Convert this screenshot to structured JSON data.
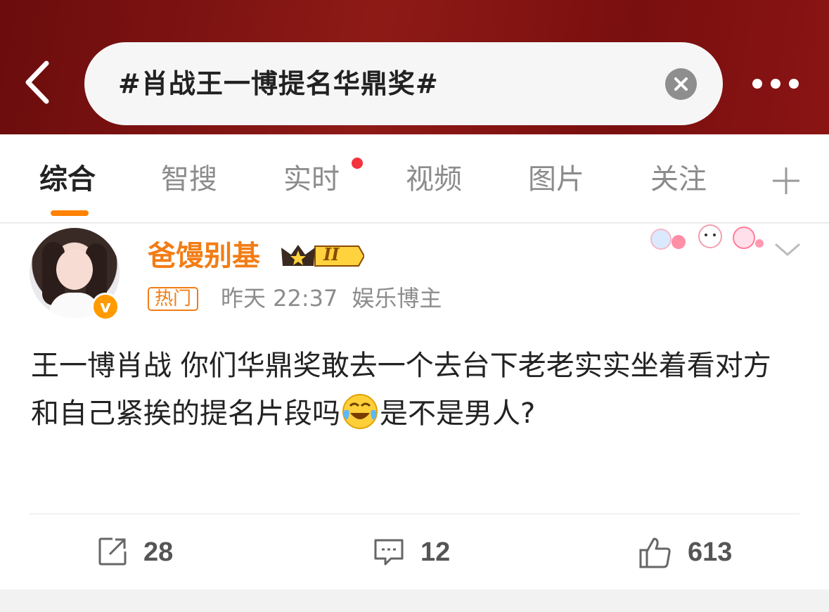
{
  "header": {
    "search_query": "#肖战王一博提名华鼎奖#"
  },
  "tabs": [
    {
      "label": "综合",
      "active": true
    },
    {
      "label": "智搜",
      "active": false
    },
    {
      "label": "实时",
      "active": false,
      "has_dot": true
    },
    {
      "label": "视频",
      "active": false
    },
    {
      "label": "图片",
      "active": false
    },
    {
      "label": "关注",
      "active": false
    }
  ],
  "post": {
    "username": "爸馒别基",
    "level_badge": "II",
    "hot_label": "热门",
    "time": "昨天 22:37",
    "category": "娱乐博主",
    "text_part1": "王一博肖战 你们华鼎奖敢去一个去台下老老实实坐着看对方和自己紧挨的提名片段吗",
    "text_part2": "是不是男人?",
    "emoji": "laugh-cry-icon",
    "reposts": "28",
    "comments": "12",
    "likes": "613"
  },
  "colors": {
    "header_red": "#8e1a16",
    "accent_orange": "#ff8200",
    "username_orange": "#f27d15",
    "dot_red": "#f5333f"
  }
}
